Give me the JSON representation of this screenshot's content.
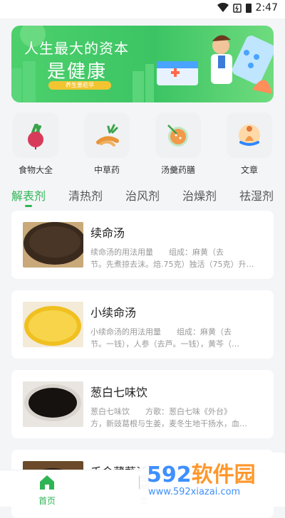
{
  "status": {
    "time": "2:47",
    "icons": [
      "wifi-icon",
      "battery-saver-icon",
      "battery-icon"
    ]
  },
  "banner": {
    "title1": "人生最大的资本",
    "title2": "是健康",
    "pill": "养生要趁早",
    "colors": {
      "bg": "#3cc464",
      "pill": "#f2c432"
    }
  },
  "categories": [
    {
      "label": "食物大全",
      "icon": "beet-icon"
    },
    {
      "label": "中草药",
      "icon": "herb-root-icon"
    },
    {
      "label": "汤羹药膳",
      "icon": "soup-bowl-icon"
    },
    {
      "label": "文章",
      "icon": "meditation-icon"
    }
  ],
  "tabs": [
    {
      "label": "解表剂",
      "active": true
    },
    {
      "label": "清热剂",
      "active": false
    },
    {
      "label": "治风剂",
      "active": false
    },
    {
      "label": "治燥剂",
      "active": false
    },
    {
      "label": "祛湿剂",
      "active": false
    }
  ],
  "cards": [
    {
      "title": "续命汤",
      "desc_line1": "续命汤的用法用量　　组成：麻黄（去",
      "desc_line2": "节。先煮掠去沫。焙.75克）独活（75克）升…"
    },
    {
      "title": "小续命汤",
      "desc_line1": "小续命汤的用法用量　　组成：麻黄（去",
      "desc_line2": "节。一钱），人参（去芦。一钱），黄芩（…"
    },
    {
      "title": "葱白七味饮",
      "desc_line1": "葱白七味饮　　方歌：葱白七味《外台》",
      "desc_line2": "方，新豉葛根与生姜，麦冬生地干扬水，血…"
    },
    {
      "title": "千金葳蕤汤",
      "desc_line1": "",
      "desc_line2": ""
    }
  ],
  "bottom_nav": [
    {
      "label": "首页",
      "active": true
    },
    {
      "label": "文",
      "active": false
    }
  ],
  "watermark": {
    "num": "592",
    "cn": "软件园",
    "url": "www.592xiazai.com"
  },
  "accent": "#2fb455"
}
